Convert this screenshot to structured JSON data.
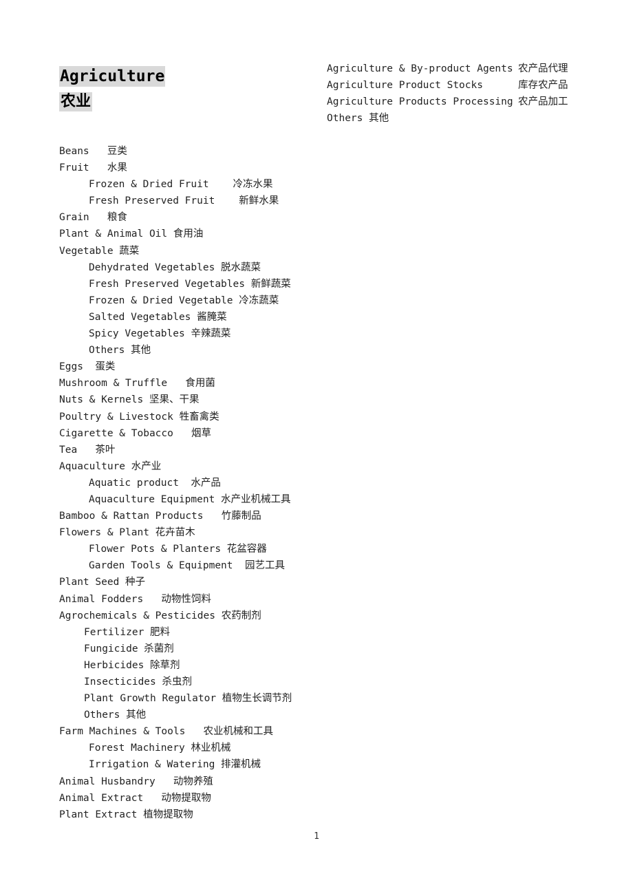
{
  "document": {
    "title_en": "Agriculture",
    "title_zh": "农业",
    "page_number": "1",
    "highlight_color": "#d9d9d9",
    "text_color": "#222222"
  },
  "right_column": {
    "items": [
      {
        "en": "Agriculture & By-product Agents",
        "zh": "农产品代理",
        "layout": "column"
      },
      {
        "en": "Agriculture Product Stocks",
        "zh": "库存农产品",
        "layout": "column"
      },
      {
        "en": "Agriculture Products Processing",
        "zh": "农产品加工",
        "layout": "column"
      },
      {
        "en": "Others ",
        "zh": "其他",
        "layout": "inline"
      }
    ]
  },
  "categories": [
    {
      "level": 1,
      "text": "Beans   豆类"
    },
    {
      "level": 1,
      "text": "Fruit   水果"
    },
    {
      "level": 2,
      "text": "Frozen & Dried Fruit    冷冻水果"
    },
    {
      "level": 2,
      "text": "Fresh Preserved Fruit    新鲜水果"
    },
    {
      "level": 1,
      "text": "Grain   粮食"
    },
    {
      "level": 1,
      "text": "Plant & Animal Oil 食用油"
    },
    {
      "level": 1,
      "text": "Vegetable 蔬菜"
    },
    {
      "level": 2,
      "text": "Dehydrated Vegetables 脱水蔬菜"
    },
    {
      "level": 2,
      "text": "Fresh Preserved Vegetables 新鲜蔬菜"
    },
    {
      "level": 2,
      "text": "Frozen & Dried Vegetable 冷冻蔬菜"
    },
    {
      "level": 2,
      "text": "Salted Vegetables 酱腌菜"
    },
    {
      "level": 2,
      "text": "Spicy Vegetables 辛辣蔬菜"
    },
    {
      "level": 2,
      "text": "Others 其他"
    },
    {
      "level": 1,
      "text": "Eggs  蛋类"
    },
    {
      "level": 1,
      "text": "Mushroom & Truffle   食用菌"
    },
    {
      "level": 1,
      "text": "Nuts & Kernels 坚果、干果"
    },
    {
      "level": 1,
      "text": "Poultry & Livestock 牲畜禽类"
    },
    {
      "level": 1,
      "text": "Cigarette & Tobacco   烟草"
    },
    {
      "level": 1,
      "text": "Tea   茶叶"
    },
    {
      "level": 1,
      "text": "Aquaculture 水产业"
    },
    {
      "level": 2,
      "text": "Aquatic product  水产品"
    },
    {
      "level": 2,
      "text": "Aquaculture Equipment 水产业机械工具"
    },
    {
      "level": 1,
      "text": "Bamboo & Rattan Products   竹藤制品"
    },
    {
      "level": 1,
      "text": "Flowers & Plant 花卉苗木"
    },
    {
      "level": 2,
      "text": "Flower Pots & Planters 花盆容器"
    },
    {
      "level": 2,
      "text": "Garden Tools & Equipment  园艺工具"
    },
    {
      "level": 1,
      "text": "Plant Seed 种子"
    },
    {
      "level": 1,
      "text": "Animal Fodders   动物性饲料"
    },
    {
      "level": 1,
      "text": "Agrochemicals & Pesticides 农药制剂"
    },
    {
      "level": 3,
      "text": "Fertilizer 肥料"
    },
    {
      "level": 3,
      "text": "Fungicide 杀菌剂"
    },
    {
      "level": 3,
      "text": "Herbicides 除草剂"
    },
    {
      "level": 3,
      "text": "Insecticides 杀虫剂"
    },
    {
      "level": 3,
      "text": "Plant Growth Regulator 植物生长调节剂"
    },
    {
      "level": 3,
      "text": "Others 其他"
    },
    {
      "level": 1,
      "text": "Farm Machines & Tools   农业机械和工具"
    },
    {
      "level": 2,
      "text": "Forest Machinery 林业机械"
    },
    {
      "level": 2,
      "text": "Irrigation & Watering 排灌机械"
    },
    {
      "level": 1,
      "text": "Animal Husbandry   动物养殖"
    },
    {
      "level": 1,
      "text": "Animal Extract   动物提取物"
    },
    {
      "level": 1,
      "text": "Plant Extract 植物提取物"
    }
  ]
}
